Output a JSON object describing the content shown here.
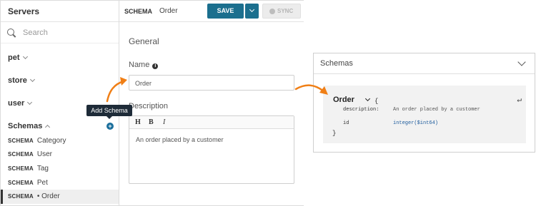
{
  "sidebar": {
    "header": "Servers",
    "search_label": "Search",
    "groups": [
      {
        "label": "pet"
      },
      {
        "label": "store"
      },
      {
        "label": "user"
      },
      {
        "label": "Schemas"
      }
    ],
    "items": [
      {
        "kind": "SCHEMA",
        "label": "Category"
      },
      {
        "kind": "SCHEMA",
        "label": "User"
      },
      {
        "kind": "SCHEMA",
        "label": "Tag"
      },
      {
        "kind": "SCHEMA",
        "label": "Pet"
      },
      {
        "kind": "SCHEMA",
        "label": "• Order"
      }
    ],
    "add_icon_glyph": "+"
  },
  "tooltip": {
    "label": "Add Schema"
  },
  "toolbar": {
    "kind": "SCHEMA",
    "name": "Order",
    "save_label": "SAVE",
    "sync_label": "SYNC"
  },
  "form": {
    "section_title": "General",
    "name_label": "Name",
    "info_glyph": "i",
    "name_value": "Order",
    "description_label": "Description",
    "format_buttons": [
      "H",
      "B",
      "I"
    ],
    "description_value": "An order placed by a customer"
  },
  "schemas_panel": {
    "title": "Schemas",
    "schema_name": "Order",
    "brace_open": "{",
    "brace_close": "}",
    "return_glyph": "↵",
    "fields": [
      {
        "key": "description:",
        "value": "An order placed by a customer"
      },
      {
        "key": "id",
        "value": "integer($int64)"
      }
    ]
  },
  "colors": {
    "primary": "#1b6f8e",
    "arrow": "#f07f16",
    "tooltip_bg": "#1e2b38",
    "type_blue": "#1b5a9c"
  }
}
